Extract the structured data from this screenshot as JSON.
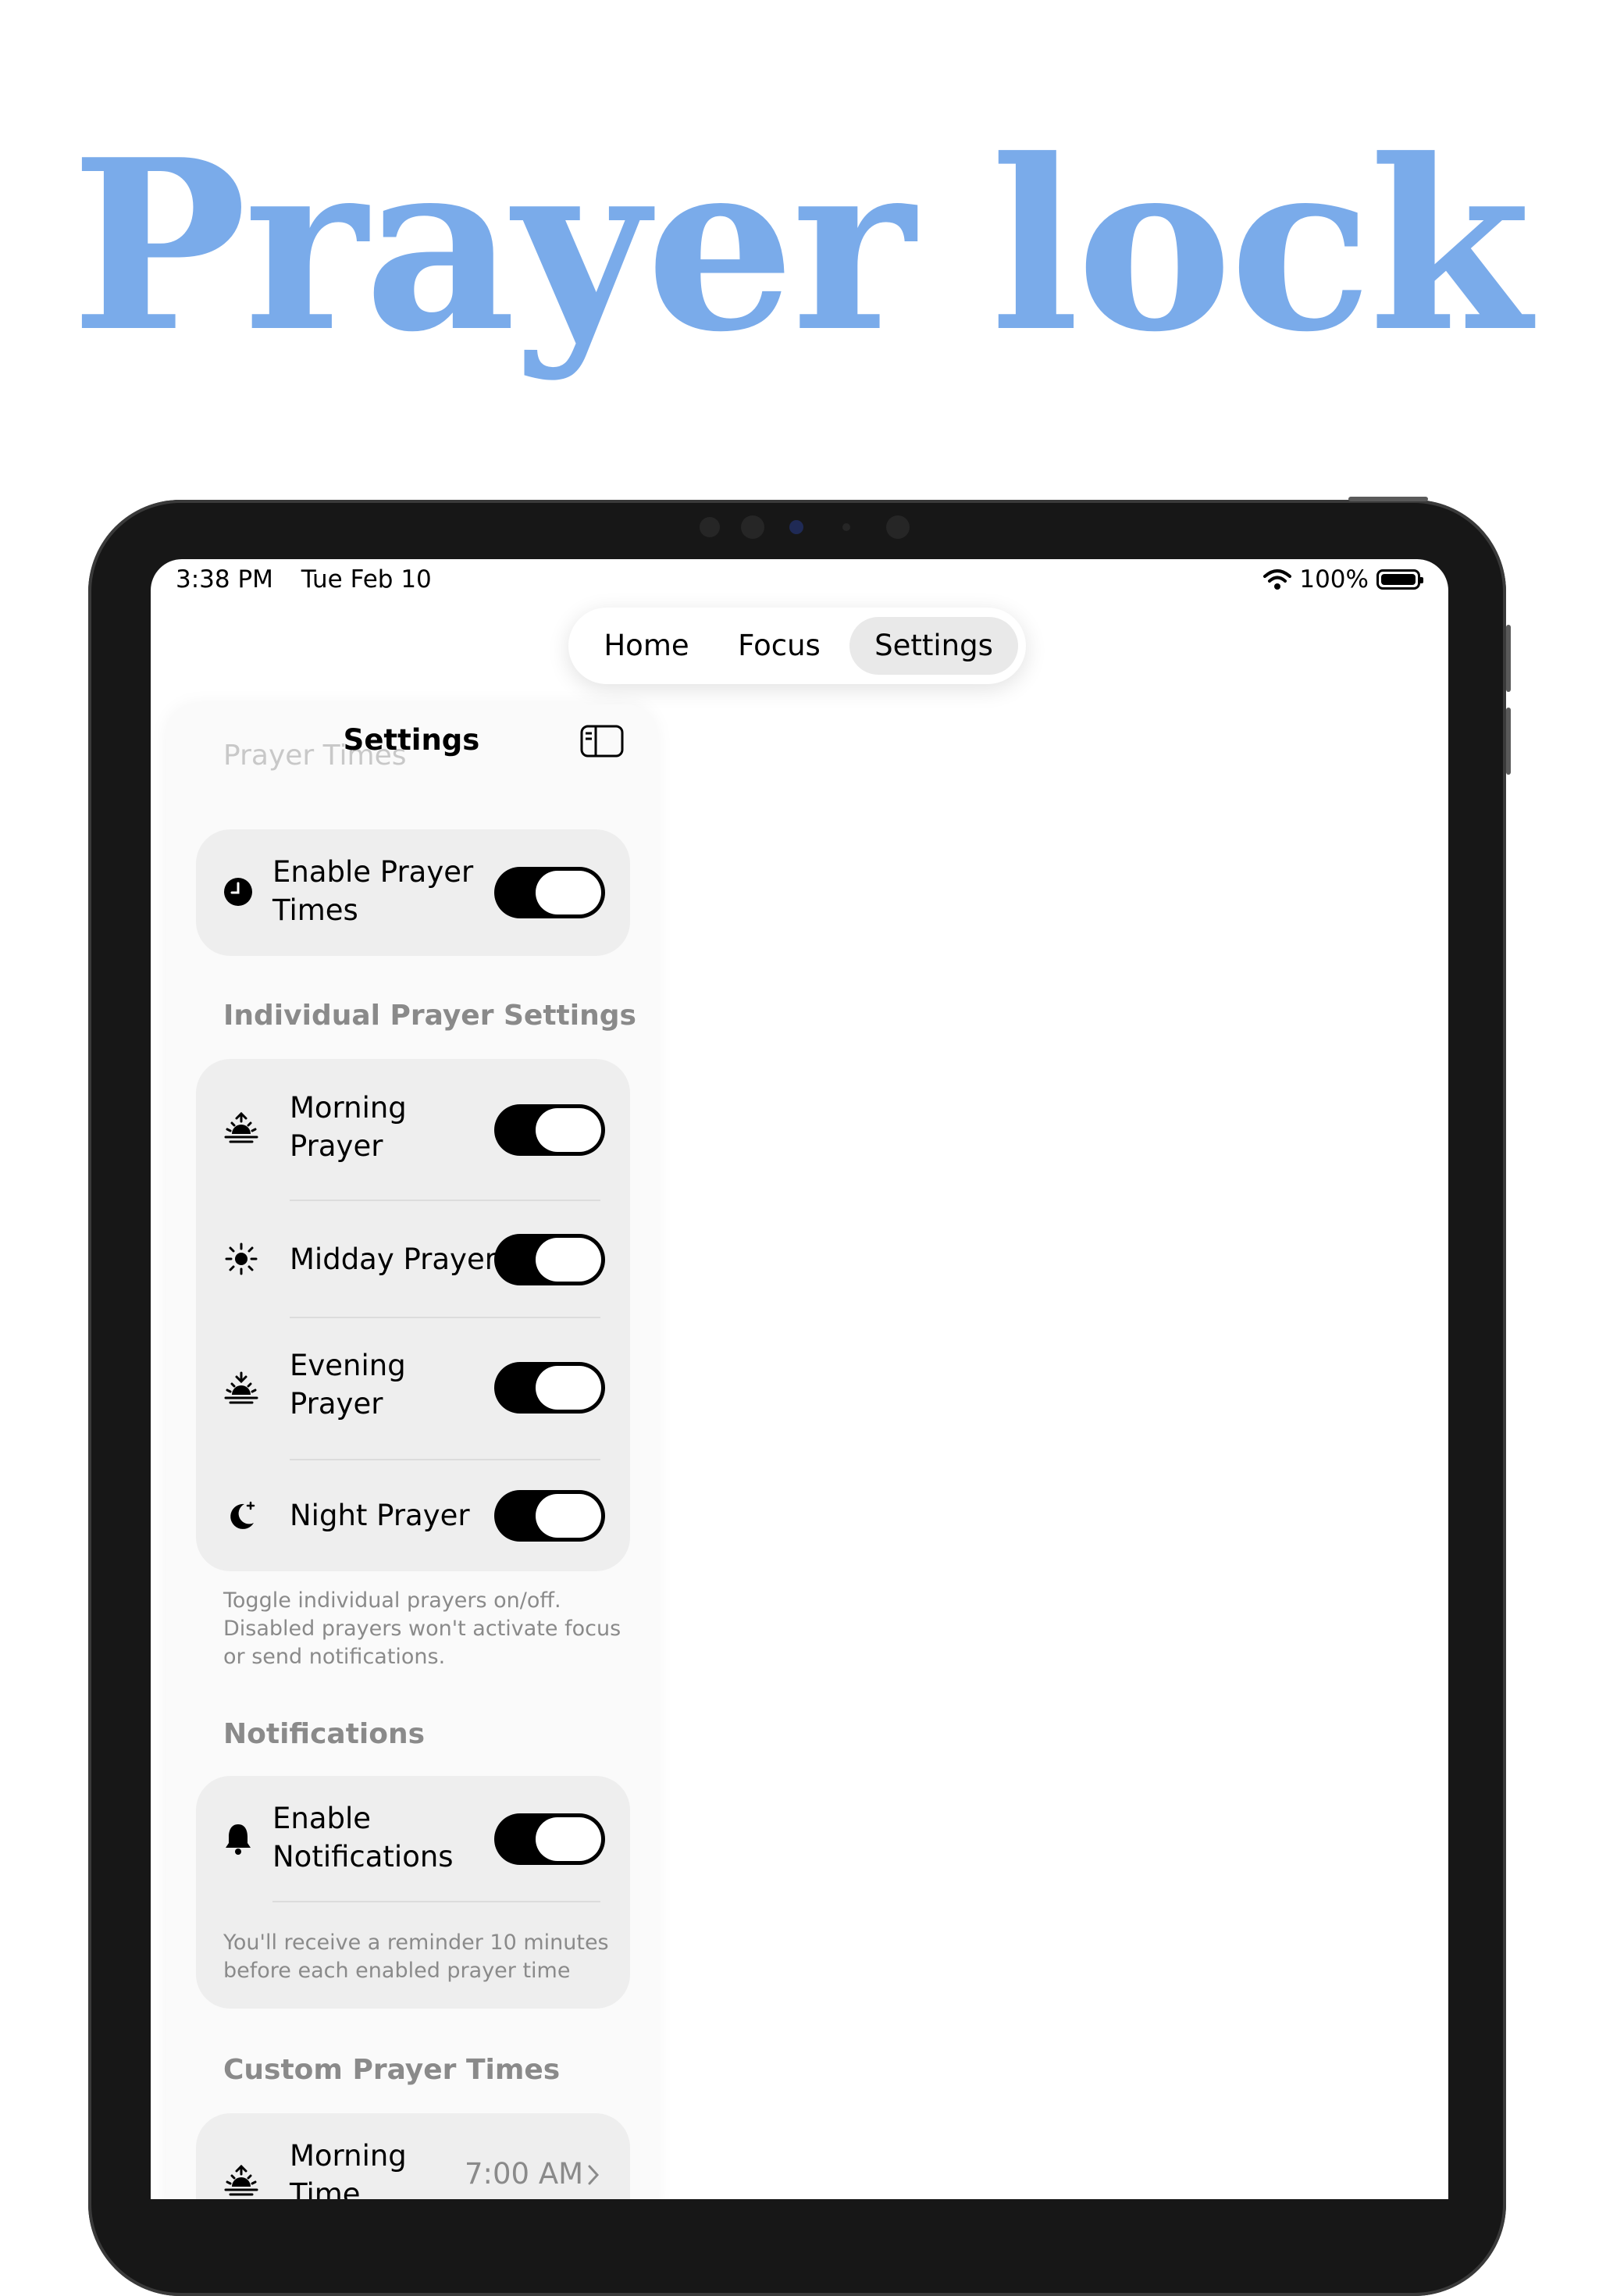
{
  "headline": "Prayer lock",
  "status_bar": {
    "time": "3:38 PM",
    "date": "Tue Feb 10",
    "battery": "100%"
  },
  "tabs": {
    "home": "Home",
    "focus": "Focus",
    "settings": "Settings"
  },
  "sidebar": {
    "title": "Settings",
    "scrolled_header": "Prayer Times",
    "enable_prayer_times": {
      "label_line1": "Enable Prayer",
      "label_line2": "Times",
      "icon": "clock-icon",
      "on": true
    },
    "individual": {
      "header": "Individual Prayer Settings",
      "items": [
        {
          "line1": "Morning",
          "line2": "Prayer",
          "icon": "sunrise-icon",
          "on": true
        },
        {
          "line1": "Midday Prayer",
          "icon": "sun-icon",
          "on": true
        },
        {
          "line1": "Evening",
          "line2": "Prayer",
          "icon": "sunset-icon",
          "on": true
        },
        {
          "line1": "Night Prayer",
          "icon": "moon-stars-icon",
          "on": true
        }
      ],
      "footnote_1": "Toggle individual prayers on/off.",
      "footnote_2": "Disabled prayers won't activate focus",
      "footnote_3": "or send notifications."
    },
    "notifications": {
      "header": "Notifications",
      "enable_line1": "Enable",
      "enable_line2": "Notifications",
      "icon": "bell-icon",
      "on": true,
      "note_1": "You'll receive a reminder 10 minutes",
      "note_2": "before each enabled prayer time"
    },
    "custom_times": {
      "header": "Custom Prayer Times",
      "item_line1": "Morning",
      "item_line2": "Time",
      "item_value": "7:00 AM",
      "icon": "sunrise-icon"
    }
  },
  "colors": {
    "headline": "#7aabea",
    "device_frame": "#171717",
    "toggle_on": "#000000"
  }
}
